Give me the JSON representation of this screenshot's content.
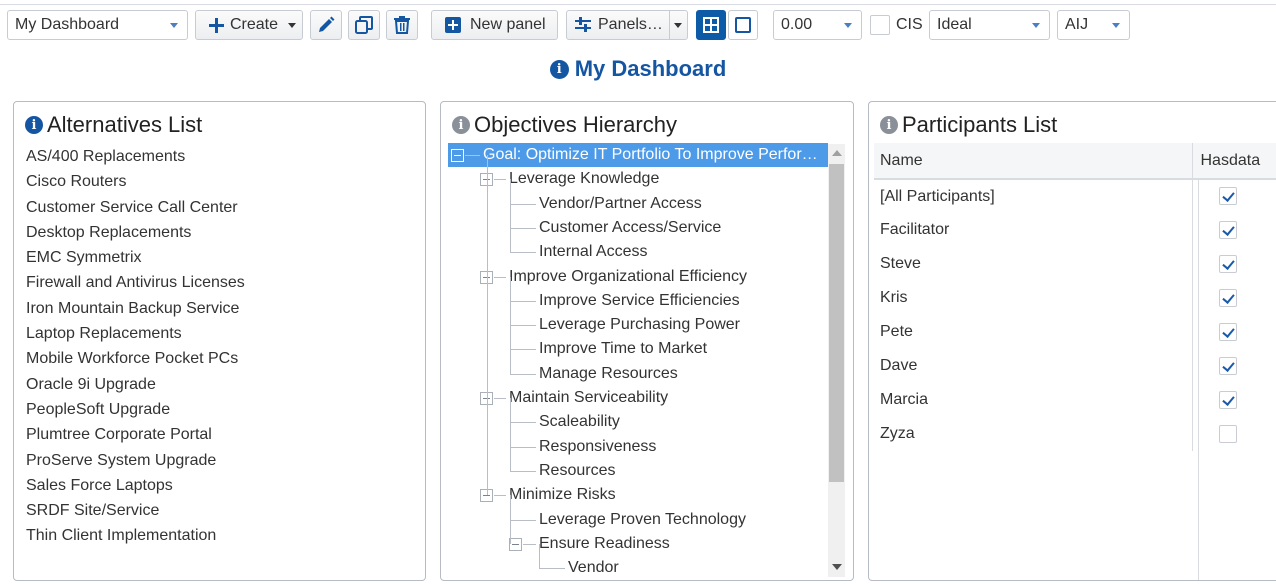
{
  "toolbar": {
    "dashboard_select": "My Dashboard",
    "create_label": "Create",
    "new_panel_label": "New panel",
    "panels_label": "Panels…",
    "number_value": "0.00",
    "cis_label": "CIS",
    "ideal_value": "Ideal",
    "aij_value": "AIJ"
  },
  "page": {
    "title": "My Dashboard"
  },
  "alternatives": {
    "title": "Alternatives List",
    "items": [
      "AS/400 Replacements",
      "Cisco Routers",
      "Customer Service Call Center",
      "Desktop Replacements",
      "EMC Symmetrix",
      "Firewall and Antivirus Licenses",
      "Iron Mountain Backup Service",
      "Laptop Replacements",
      "Mobile Workforce Pocket PCs",
      "Oracle 9i Upgrade",
      "PeopleSoft Upgrade",
      "Plumtree Corporate Portal",
      "ProServe System Upgrade",
      "Sales Force Laptops",
      "SRDF Site/Service",
      "Thin Client Implementation"
    ]
  },
  "objectives": {
    "title": "Objectives Hierarchy",
    "goal": "Goal: Optimize IT Portfolio To Improve Perfor…",
    "groups": [
      {
        "label": "Leverage Knowledge",
        "children": [
          "Vendor/Partner Access",
          "Customer Access/Service",
          "Internal Access"
        ]
      },
      {
        "label": "Improve Organizational Efficiency",
        "children": [
          "Improve Service Efficiencies",
          "Leverage Purchasing Power",
          "Improve Time to Market",
          "Manage Resources"
        ]
      },
      {
        "label": "Maintain Serviceability",
        "children": [
          "Scaleability",
          "Responsiveness",
          "Resources"
        ]
      },
      {
        "label": "Minimize Risks",
        "children": [
          "Leverage Proven Technology",
          "Ensure Readiness"
        ]
      }
    ],
    "grandchild": "Vendor"
  },
  "participants": {
    "title": "Participants List",
    "col_name": "Name",
    "col_hasdata": "Hasdata",
    "rows": [
      {
        "name": "[All Participants]",
        "hasdata": true
      },
      {
        "name": "Facilitator",
        "hasdata": true
      },
      {
        "name": "Steve",
        "hasdata": true
      },
      {
        "name": "Kris",
        "hasdata": true
      },
      {
        "name": "Pete",
        "hasdata": true
      },
      {
        "name": "Dave",
        "hasdata": true
      },
      {
        "name": "Marcia",
        "hasdata": true
      },
      {
        "name": "Zyza",
        "hasdata": false
      }
    ]
  },
  "colors": {
    "accent": "#1556a3",
    "selection": "#4c9ae8",
    "info_blue": "#1556a3",
    "info_grey": "#8a9099"
  }
}
